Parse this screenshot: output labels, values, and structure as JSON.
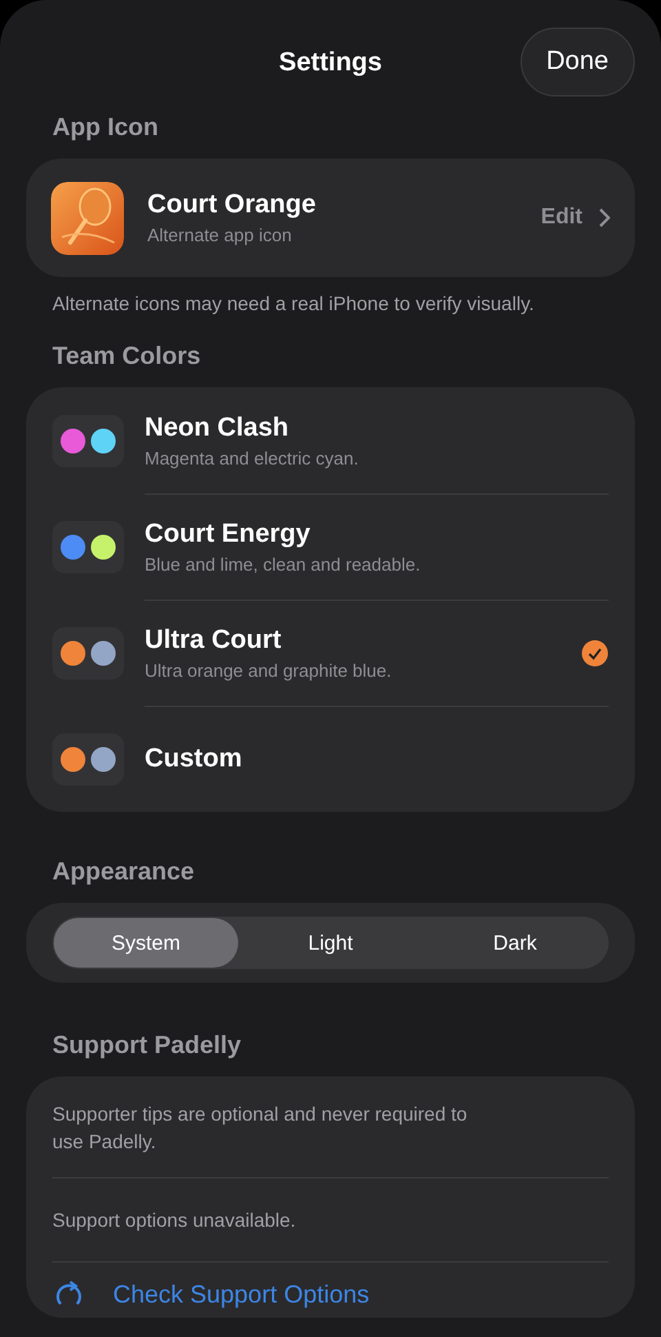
{
  "header": {
    "title": "Settings",
    "done": "Done"
  },
  "app_icon": {
    "heading": "App Icon",
    "name": "Court Orange",
    "subtitle": "Alternate app icon",
    "action": "Edit",
    "footnote": "Alternate icons may need a real iPhone to verify visually."
  },
  "team_colors": {
    "heading": "Team Colors",
    "items": [
      {
        "name": "Neon Clash",
        "subtitle": "Magenta and electric cyan.",
        "swatches": [
          {
            "color": "#e85ad8"
          },
          {
            "color": "#5fd3f6"
          }
        ],
        "selected": false
      },
      {
        "name": "Court Energy",
        "subtitle": "Blue and lime, clean and readable.",
        "swatches": [
          {
            "color": "#4d8cf5"
          },
          {
            "color": "#c5f26a"
          }
        ],
        "selected": false
      },
      {
        "name": "Ultra Court",
        "subtitle": "Ultra orange and graphite blue.",
        "swatches": [
          {
            "color": "#f0843a"
          },
          {
            "color": "#94a6c6"
          }
        ],
        "selected": true
      },
      {
        "name": "Custom",
        "swatches": [
          {
            "color": "#f0843a"
          },
          {
            "color": "#94a6c6"
          }
        ],
        "selected": false
      }
    ]
  },
  "appearance": {
    "heading": "Appearance",
    "options": [
      {
        "label": "System",
        "selected": true
      },
      {
        "label": "Light",
        "selected": false
      },
      {
        "label": "Dark",
        "selected": false
      }
    ]
  },
  "support": {
    "heading": "Support Padelly",
    "note": "Supporter tips are optional and never required to use Padelly.",
    "status": "Support options unavailable.",
    "action": "Check Support Options"
  }
}
